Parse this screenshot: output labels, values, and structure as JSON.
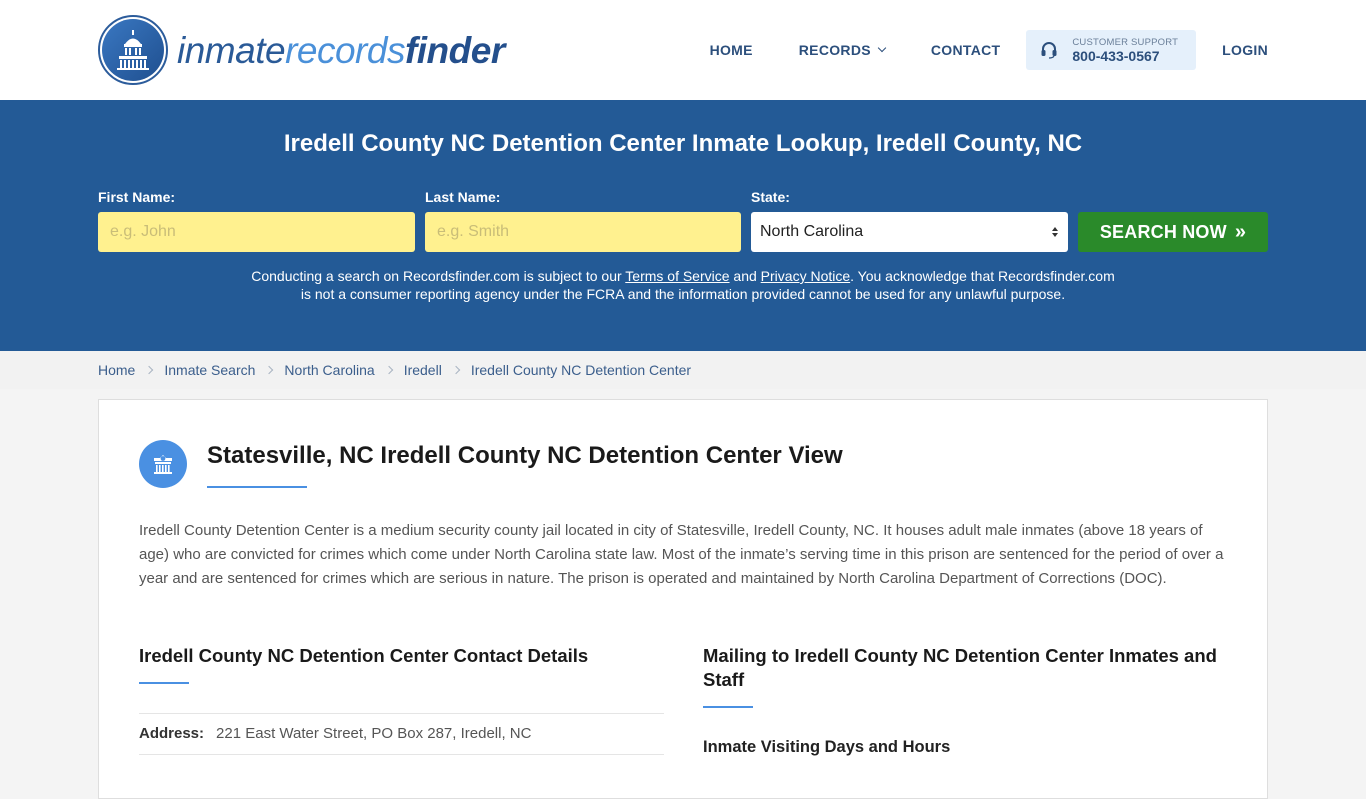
{
  "header": {
    "logo": {
      "part1": "inmate",
      "part2": "records",
      "part3": "finder"
    },
    "nav": [
      {
        "label": "HOME"
      },
      {
        "label": "RECORDS",
        "has_dropdown": true
      },
      {
        "label": "CONTACT"
      }
    ],
    "support": {
      "label": "CUSTOMER SUPPORT",
      "phone": "800-433-0567",
      "icon": "headset-icon"
    },
    "login_label": "LOGIN"
  },
  "search": {
    "title": "Iredell County NC Detention Center Inmate Lookup, Iredell County, NC",
    "first_name": {
      "label": "First Name:",
      "placeholder": "e.g. John",
      "value": ""
    },
    "last_name": {
      "label": "Last Name:",
      "placeholder": "e.g. Smith",
      "value": ""
    },
    "state": {
      "label": "State:",
      "selected": "North Carolina"
    },
    "button_label": "SEARCH NOW",
    "button_icon": "»",
    "colors": {
      "banner": "#235a96",
      "input_bg": "#fff18f",
      "button": "#2a8a2a"
    },
    "disclaimer": {
      "part1": "Conducting a search on Recordsfinder.com is subject to our ",
      "terms_link": "Terms of Service",
      "part2": " and ",
      "privacy_link": "Privacy Notice",
      "part3": ". You acknowledge that Recordsfinder.com is not a consumer reporting agency under the FCRA and the information provided cannot be used for any unlawful purpose."
    }
  },
  "breadcrumb": [
    {
      "label": "Home"
    },
    {
      "label": "Inmate Search"
    },
    {
      "label": "North Carolina"
    },
    {
      "label": "Iredell"
    },
    {
      "label": "Iredell County NC Detention Center"
    }
  ],
  "main": {
    "title": "Statesville, NC Iredell County NC Detention Center View",
    "icon": "jail-building-icon",
    "description": "Iredell County Detention Center is a medium security county jail located in city of Statesville, Iredell County, NC. It houses adult male inmates (above 18 years of age) who are convicted for crimes which come under North Carolina state law. Most of the inmate’s serving time in this prison are sentenced for the period of over a year and are sentenced for crimes which are serious in nature. The prison is operated and maintained by North Carolina Department of Corrections (DOC).",
    "contact": {
      "title": "Iredell County NC Detention Center Contact Details",
      "address_label": "Address:",
      "address_value": "221 East Water Street, PO Box 287, Iredell, NC"
    },
    "mailing": {
      "title": "Mailing to Iredell County NC Detention Center Inmates and Staff",
      "visiting_title": "Inmate Visiting Days and Hours"
    },
    "accent_color": "#4a90e2"
  }
}
